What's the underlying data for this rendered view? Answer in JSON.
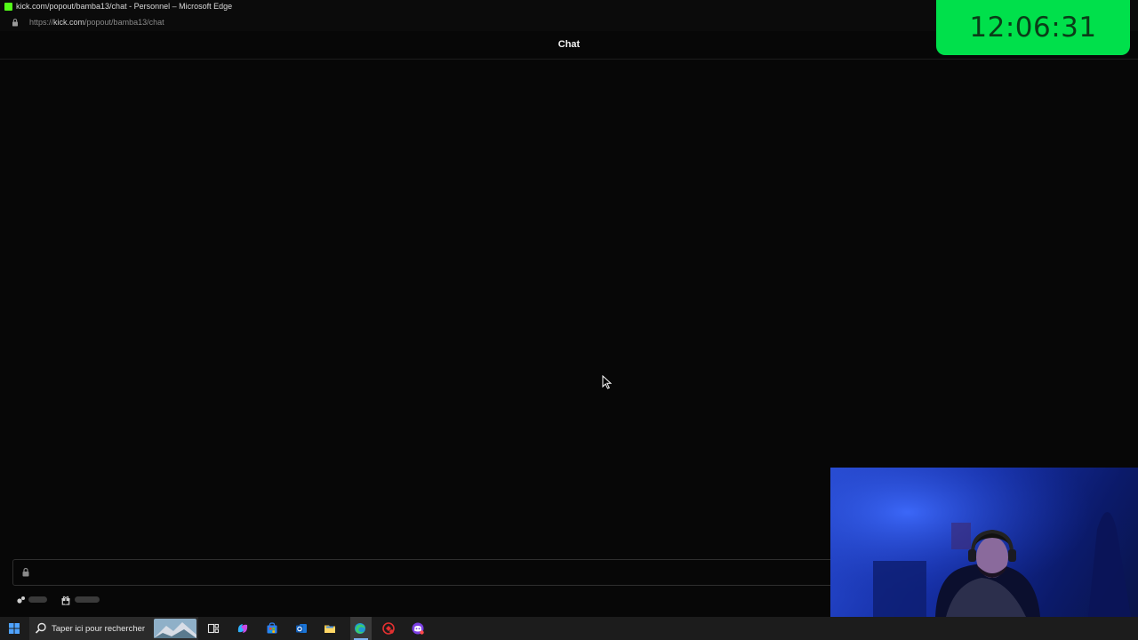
{
  "browser": {
    "window_title": "kick.com/popout/bamba13/chat - Personnel – Microsoft Edge",
    "url_scheme": "https://",
    "url_host": "kick.com",
    "url_path": "/popout/bamba13/chat"
  },
  "chat": {
    "title": "Chat"
  },
  "overlay": {
    "clock": "12:06:31"
  },
  "taskbar": {
    "search_placeholder": "Taper ici pour rechercher"
  },
  "colors": {
    "page_bg": "#070707",
    "clock_bg": "#00e04b",
    "brand_green": "#53fc18",
    "webcam_tint": "#1630a8"
  },
  "icons": [
    "kick-logo-icon",
    "lock-icon",
    "chat-lock-icon",
    "emote-icon",
    "gift-icon",
    "windows-start-icon",
    "search-icon",
    "task-view-icon",
    "copilot-icon",
    "store-icon",
    "outlook-icon",
    "file-explorer-icon",
    "edge-icon",
    "app-red-icon",
    "app-discord-icon",
    "mouse-cursor-icon"
  ]
}
